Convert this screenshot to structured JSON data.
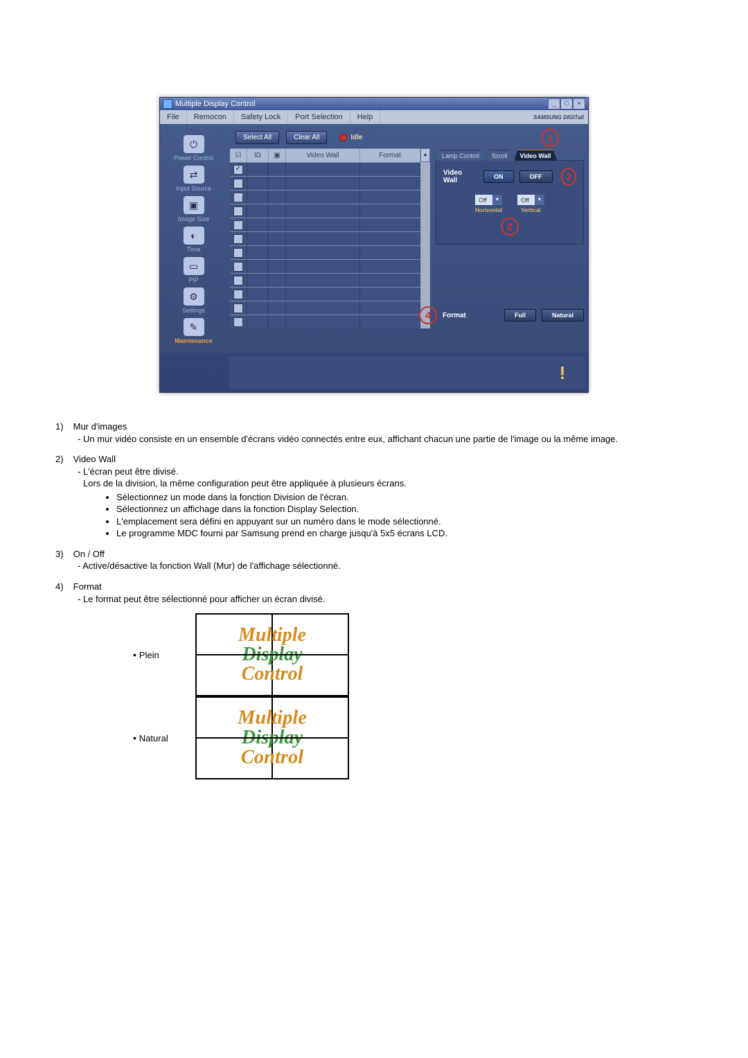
{
  "app": {
    "title": "Multiple Display Control",
    "brand": "SAMSUNG DIGITall",
    "menu": [
      "File",
      "Remocon",
      "Safety Lock",
      "Port Selection",
      "Help"
    ],
    "window_buttons": [
      "_",
      "□",
      "×"
    ],
    "toolbar": {
      "select_all": "Select All",
      "clear_all": "Clear All",
      "idle": "Idle"
    },
    "sidebar": [
      {
        "label": "Power Control",
        "icon": "⏻"
      },
      {
        "label": "Input Source",
        "icon": "⇄"
      },
      {
        "label": "Image Size",
        "icon": "▣"
      },
      {
        "label": "Time",
        "icon": "◐"
      },
      {
        "label": "PIP",
        "icon": "▭"
      },
      {
        "label": "Settings",
        "icon": "⚙"
      },
      {
        "label": "Maintenance",
        "icon": "✎",
        "active": true
      }
    ],
    "grid": {
      "headers": {
        "chk": "☑",
        "id": "ID",
        "st": "▣",
        "vw": "Video Wall",
        "fmt": "Format"
      },
      "rows": 12
    },
    "right": {
      "tabs": [
        "Lamp Control",
        "Scroll",
        "Video Wall"
      ],
      "active_tab": 2,
      "video_wall_label": "Video Wall",
      "on": "ON",
      "off": "OFF",
      "h_value": "Off",
      "v_value": "Off",
      "h_label": "Horizontal",
      "v_label": "Vertical",
      "format_label": "Format",
      "full": "Full",
      "natural": "Natural"
    },
    "callouts": {
      "c1": "1",
      "c2": "2",
      "c3": "3",
      "c4": "4"
    }
  },
  "doc": {
    "items": [
      {
        "num": "1)",
        "title": "Mur d'images",
        "lines": [
          "- Un mur vidéo consiste en un ensemble d'écrans vidéo connectés entre eux, affichant chacun une partie de l'image ou la même image."
        ]
      },
      {
        "num": "2)",
        "title": "Video Wall",
        "lines": [
          "- L'écran peut être divisé.",
          "Lors de la division, la même configuration peut être appliquée à plusieurs écrans."
        ],
        "bullets": [
          "Sélectionnez un mode dans la fonction Division de l'écran.",
          "Sélectionnez un affichage dans la fonction Display Selection.",
          "L'emplacement sera défini en appuyant sur un numéro dans le mode sélectionné.",
          "Le programme MDC fourni par Samsung prend en charge jusqu'à 5x5 écrans LCD."
        ]
      },
      {
        "num": "3)",
        "title": "On / Off",
        "lines": [
          "- Active/désactive la fonction Wall (Mur) de l'affichage sélectionné."
        ]
      },
      {
        "num": "4)",
        "title": "Format",
        "lines": [
          "- Le format peut être sélectionné pour afficher un écran divisé."
        ]
      }
    ],
    "plein": "Plein",
    "natural": "Natural",
    "thumb_lines": [
      "Multiple",
      "Display",
      "Control"
    ]
  }
}
